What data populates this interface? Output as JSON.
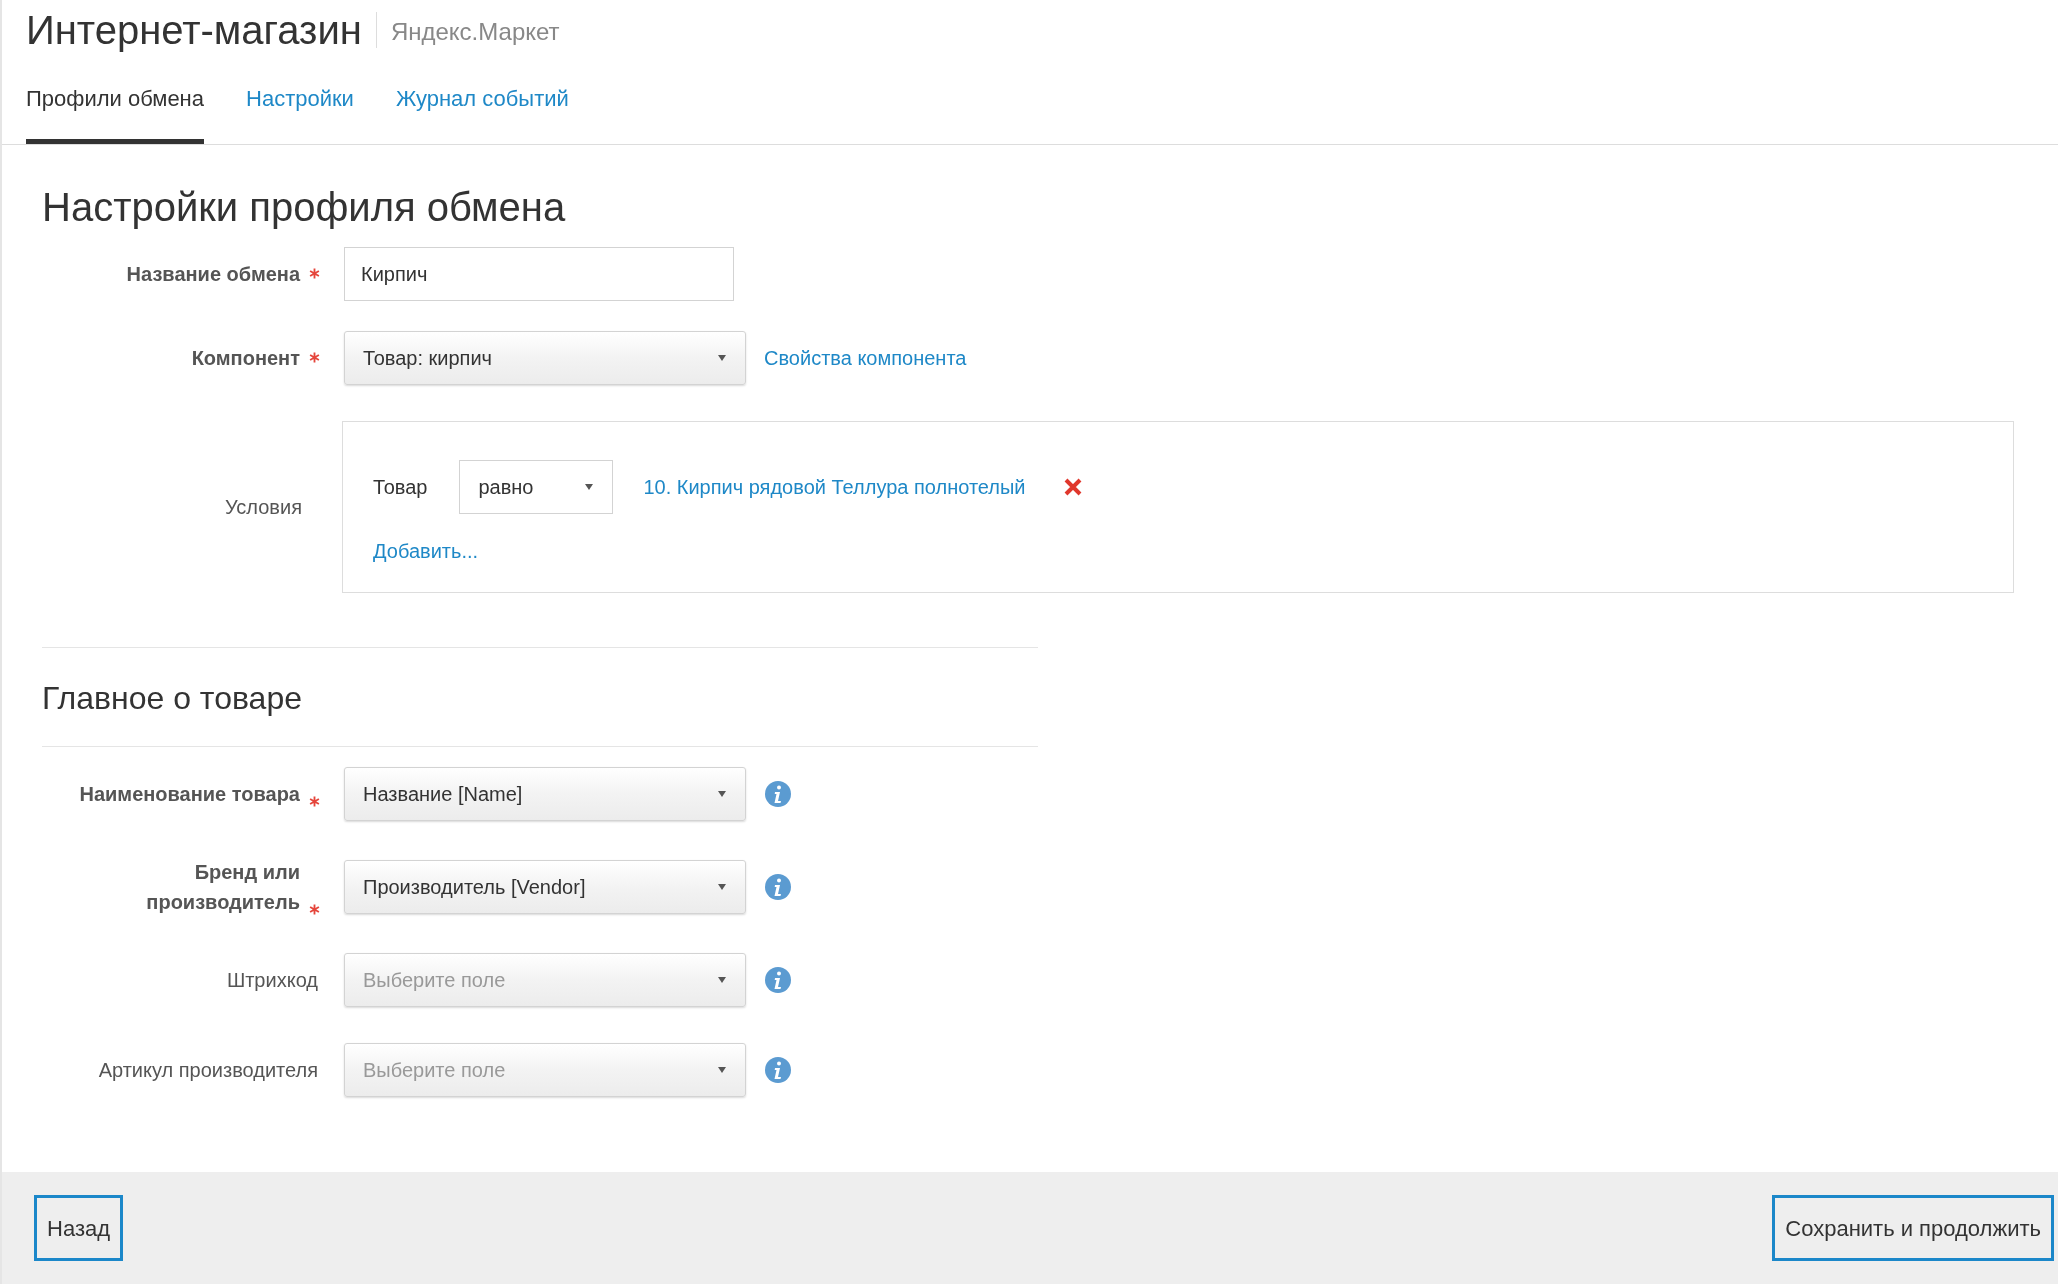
{
  "header": {
    "title": "Интернет-магазин",
    "subtitle": "Яндекс.Маркет"
  },
  "tabs": [
    {
      "label": "Профили обмена",
      "selected": true
    },
    {
      "label": "Настройки",
      "selected": false
    },
    {
      "label": "Журнал событий",
      "selected": false
    }
  ],
  "page_title": "Настройки профиля обмена",
  "exchange_name": {
    "label": "Название обмена",
    "required": true,
    "value": "Кирпич"
  },
  "component": {
    "label": "Компонент",
    "required": true,
    "value": "Товар: кирпич",
    "link": "Свойства компонента"
  },
  "conditions": {
    "label": "Условия",
    "field": "Товар",
    "operator": "равно",
    "value_link": "10. Кирпич рядовой Теллура полнотелый",
    "add_link": "Добавить..."
  },
  "section_title": "Главное о товаре",
  "fields": [
    {
      "label": "Наименование товара",
      "required": true,
      "value": "Название [Name]"
    },
    {
      "label": "Бренд или производитель",
      "required": true,
      "value": "Производитель [Vendor]"
    },
    {
      "label": "Штрихкод",
      "required": false,
      "placeholder": "Выберите поле"
    },
    {
      "label": "Артикул производителя",
      "required": false,
      "placeholder": "Выберите поле"
    }
  ],
  "footer": {
    "back": "Назад",
    "save": "Сохранить и продолжить"
  }
}
